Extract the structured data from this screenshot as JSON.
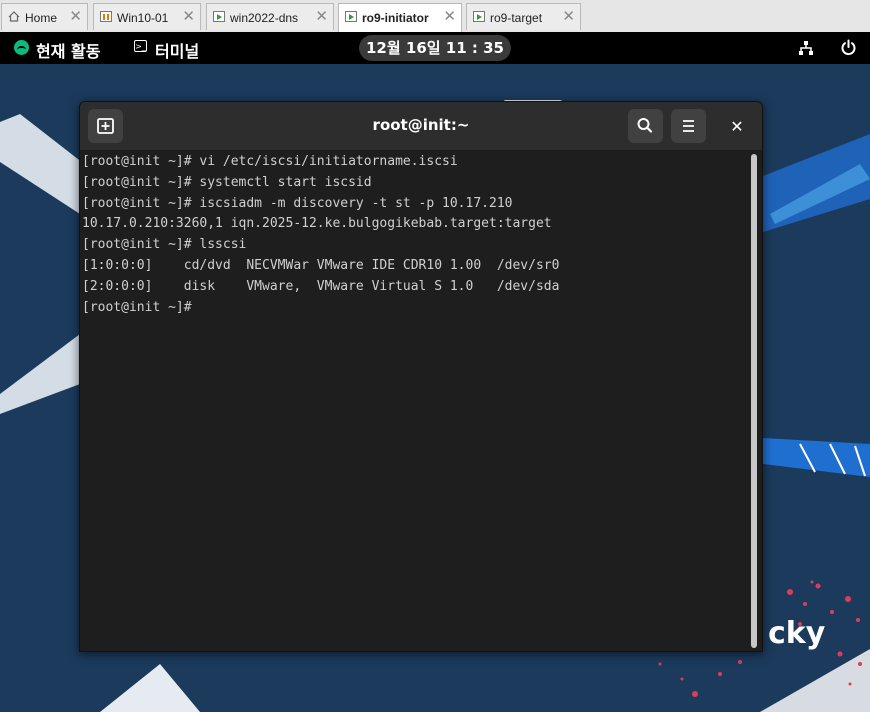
{
  "tabs": [
    {
      "label": "Home",
      "icon": "home-icon"
    },
    {
      "label": "Win10-01",
      "icon": "vm-paused-icon"
    },
    {
      "label": "win2022-dns",
      "icon": "vm-running-icon"
    },
    {
      "label": "ro9-initiator",
      "icon": "vm-running-icon",
      "active": true
    },
    {
      "label": "ro9-target",
      "icon": "vm-running-icon"
    }
  ],
  "topbar": {
    "activities": "현재 활동",
    "app_name": "터미널",
    "clock": "12월 16일  11 : 35"
  },
  "terminal": {
    "title": "root@init:~",
    "lines": [
      "[root@init ~]# vi /etc/iscsi/initiatorname.iscsi",
      "[root@init ~]# systemctl start iscsid",
      "[root@init ~]# iscsiadm -m discovery -t st -p 10.17.210",
      "10.17.0.210:3260,1 iqn.2025-12.ke.bulgogikebab.target:target",
      "[root@init ~]# lsscsi",
      "[1:0:0:0]    cd/dvd  NECVMWar VMware IDE CDR10 1.00  /dev/sr0",
      "[2:0:0:0]    disk    VMware,  VMware Virtual S 1.0   /dev/sda",
      "[root@init ~]#"
    ]
  },
  "wallpaper": {
    "brand_text": "cky",
    "colors": {
      "background": "#1b3a5c",
      "accent": "#10b981"
    }
  }
}
